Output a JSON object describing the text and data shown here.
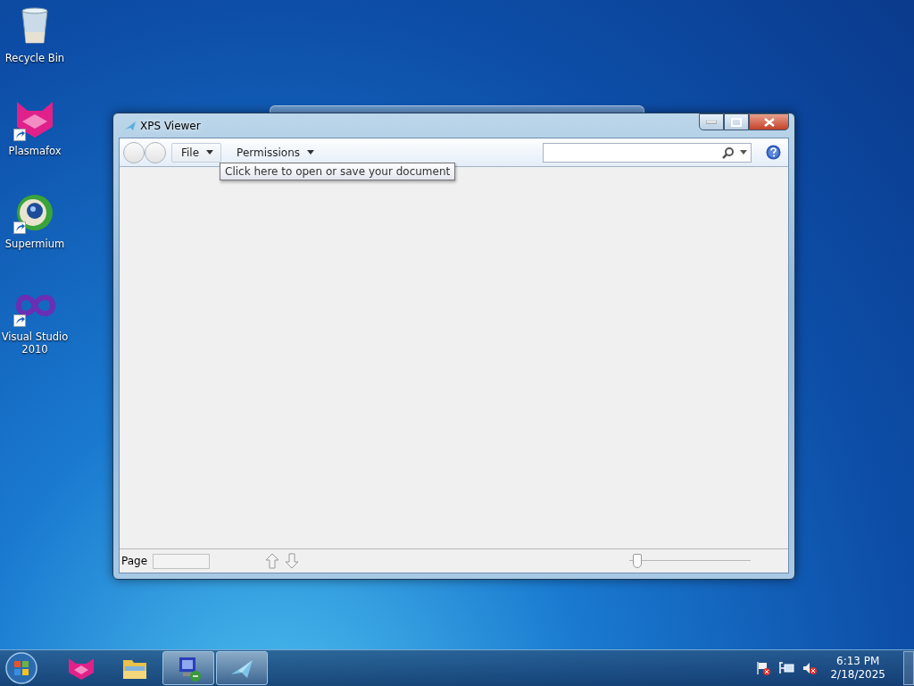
{
  "desktop_icons": [
    {
      "label": "Recycle Bin",
      "kind": "trash",
      "shortcut": false
    },
    {
      "label": "Plasmafox",
      "kind": "fox",
      "shortcut": true
    },
    {
      "label": "Supermium",
      "kind": "globe",
      "shortcut": true
    },
    {
      "label": "Visual Studio 2010",
      "kind": "infinity",
      "shortcut": true
    }
  ],
  "window": {
    "title": "XPS Viewer",
    "menus": [
      {
        "label": "File"
      },
      {
        "label": "Permissions"
      }
    ],
    "tooltip": "Click here to open or save your document",
    "status_bar": {
      "page_label": "Page",
      "zoom": {
        "level": 0.03
      }
    }
  },
  "taskbar": {
    "items": [
      {
        "kind": "fox",
        "active": false
      },
      {
        "kind": "folder",
        "active": false
      },
      {
        "kind": "computer",
        "active": true
      },
      {
        "kind": "viewer",
        "active": true
      }
    ],
    "clock": {
      "time": "6:13 PM",
      "date": "2/18/2025"
    }
  }
}
